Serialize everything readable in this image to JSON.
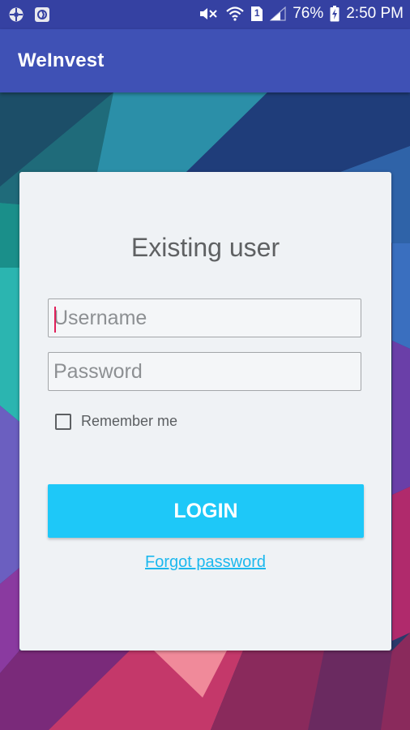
{
  "status_bar": {
    "battery_percent": "76%",
    "time": "2:50 PM",
    "sim_slot": "1",
    "icons": [
      "app-notification-icon",
      "app-notification-icon-2",
      "mute-icon",
      "wifi-icon",
      "sim-icon",
      "signal-icon",
      "battery-charging-icon"
    ]
  },
  "app_bar": {
    "title": "WeInvest"
  },
  "login_card": {
    "title": "Existing user",
    "username": {
      "placeholder": "Username",
      "value": ""
    },
    "password": {
      "placeholder": "Password",
      "value": ""
    },
    "remember_me": {
      "label": "Remember me",
      "checked": false
    },
    "login_button": "LOGIN",
    "forgot_password": "Forgot password"
  },
  "colors": {
    "status_bar": "#3541a2",
    "app_bar": "#3f51b5",
    "card_background": "#eff2f5",
    "login_button": "#1ec8f8",
    "link": "#1cb8ee",
    "caret": "#e0205a"
  }
}
